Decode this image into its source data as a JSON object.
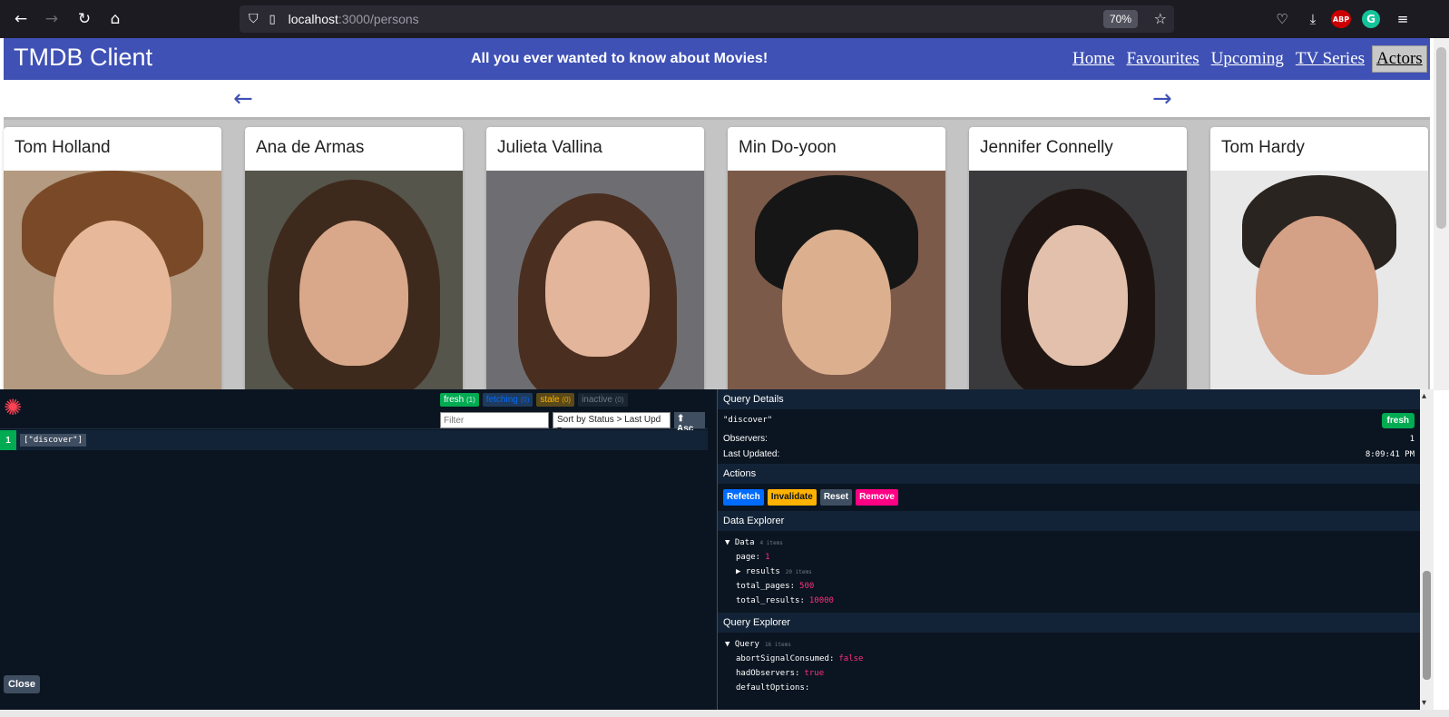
{
  "browser": {
    "url_host": "localhost",
    "url_path": ":3000/persons",
    "zoom": "70%"
  },
  "header": {
    "title": "TMDB Client",
    "tagline": "All you ever wanted to know about Movies!",
    "menu": [
      {
        "label": "Home"
      },
      {
        "label": "Favourites"
      },
      {
        "label": "Upcoming"
      },
      {
        "label": "TV Series"
      },
      {
        "label": "Actors"
      }
    ],
    "active_menu": "Actors"
  },
  "actors": [
    {
      "name": "Tom Holland"
    },
    {
      "name": "Ana de Armas"
    },
    {
      "name": "Julieta Vallina"
    },
    {
      "name": "Min Do-yoon"
    },
    {
      "name": "Jennifer Connelly"
    },
    {
      "name": "Tom Hardy"
    }
  ],
  "devtools": {
    "badges": {
      "fresh": "fresh",
      "fresh_count": "(1)",
      "fetching": "fetching",
      "fetching_count": "(0)",
      "stale": "stale",
      "stale_count": "(0)",
      "inactive": "inactive",
      "inactive_count": "(0)"
    },
    "filter_placeholder": "Filter",
    "sort_label": "Sort by Status > Last Upd",
    "asc_label": "⬆ Asc",
    "query_count": "1",
    "query_key": "[\"discover\"]",
    "close_label": "Close",
    "details": {
      "title": "Query Details",
      "key": "\"discover\"",
      "status": "fresh",
      "observers_label": "Observers:",
      "observers": "1",
      "updated_label": "Last Updated:",
      "updated": "8:09:41 PM"
    },
    "actions": {
      "title": "Actions",
      "refetch": "Refetch",
      "invalidate": "Invalidate",
      "reset": "Reset",
      "remove": "Remove"
    },
    "data_explorer": {
      "title": "Data Explorer",
      "root": "▼ Data",
      "root_count": "4 items",
      "page_key": "page:",
      "page_val": "1",
      "results_key": "▶ results",
      "results_count": "20 items",
      "total_pages_key": "total_pages:",
      "total_pages_val": "500",
      "total_results_key": "total_results:",
      "total_results_val": "10000"
    },
    "query_explorer": {
      "title": "Query Explorer",
      "root": "▼ Query",
      "root_count": "16 items",
      "abort_key": "abortSignalConsumed:",
      "abort_val": "false",
      "had_key": "hadObservers:",
      "had_val": "true",
      "default_key": "defaultOptions:"
    }
  }
}
